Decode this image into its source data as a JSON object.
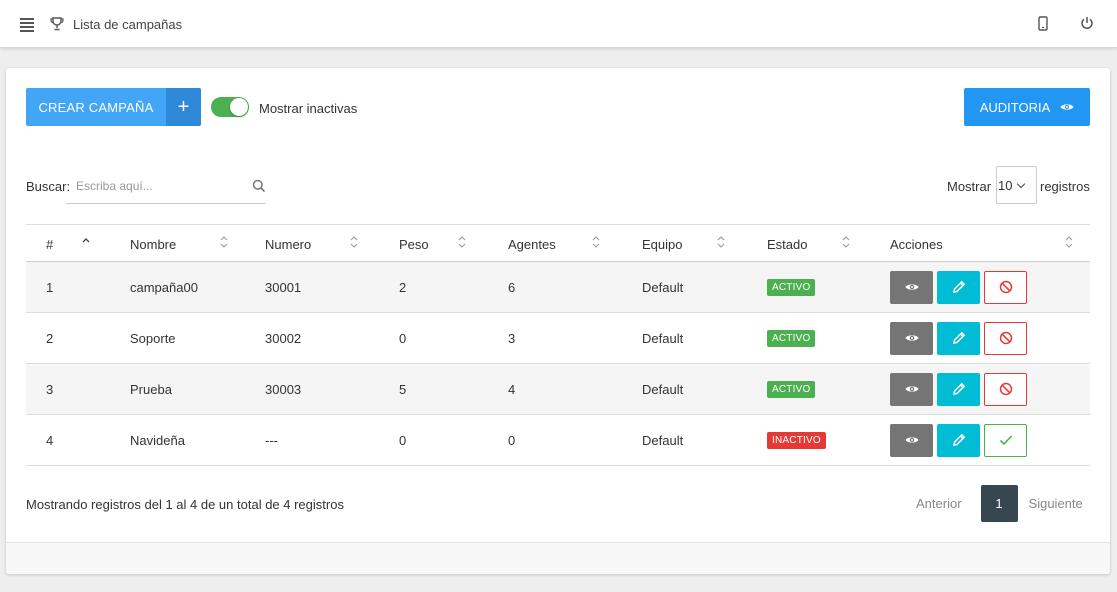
{
  "header": {
    "title": "Lista de campañas",
    "icons": [
      "menu-icon",
      "trophy-icon",
      "phone-icon",
      "power-icon"
    ]
  },
  "toolbar": {
    "create_label": "CREAR CAMPAÑA",
    "create_plus": "+",
    "toggle_label": "Mostrar inactivas",
    "toggle_on": true,
    "audit_label": "AUDITORIA"
  },
  "search": {
    "label": "Buscar:",
    "placeholder": "Escriba aquí..."
  },
  "page_size": {
    "label": "Mostrar",
    "value": "10",
    "suffix": "registros"
  },
  "table": {
    "columns": [
      "#",
      "Nombre",
      "Numero",
      "Peso",
      "Agentes",
      "Equipo",
      "Estado",
      "Acciones"
    ],
    "rows": [
      {
        "num": "1",
        "nombre": "campaña00",
        "numero": "30001",
        "peso": "2",
        "agentes": "6",
        "equipo": "Default",
        "estado": "ACTIVO"
      },
      {
        "num": "2",
        "nombre": "Soporte",
        "numero": "30002",
        "peso": "0",
        "agentes": "3",
        "equipo": "Default",
        "estado": "ACTIVO"
      },
      {
        "num": "3",
        "nombre": "Prueba",
        "numero": "30003",
        "peso": "5",
        "agentes": "4",
        "equipo": "Default",
        "estado": "ACTIVO"
      },
      {
        "num": "4",
        "nombre": "Navideña",
        "numero": "---",
        "peso": "0",
        "agentes": "0",
        "equipo": "Default",
        "estado": "INACTIVO"
      }
    ]
  },
  "footer": {
    "info": "Mostrando registros del 1 al 4 de un total de 4 registros",
    "prev": "Anterior",
    "page": "1",
    "next": "Siguiente"
  },
  "colors": {
    "primary": "#42a5f5",
    "audit": "#2196f3",
    "active": "#4caf50",
    "inactive": "#e53935",
    "edit": "#00bcd4",
    "view": "#757575",
    "pager": "#37474f"
  }
}
